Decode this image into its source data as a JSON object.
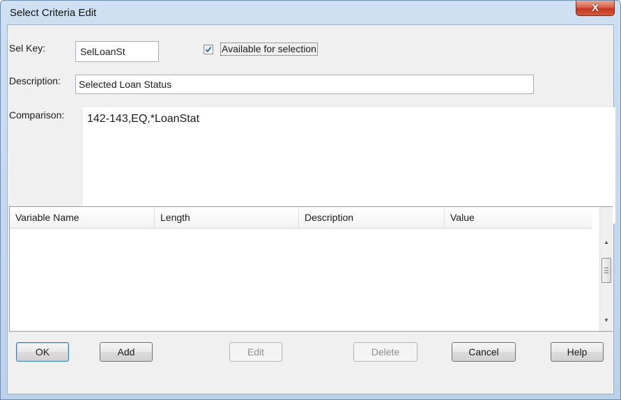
{
  "window": {
    "title": "Select Criteria Edit",
    "close_glyph": "X"
  },
  "form": {
    "sel_key_label": "Sel Key:",
    "sel_key_value": "SelLoanSt",
    "available_checked": true,
    "available_label": "Available for selection",
    "description_label": "Description:",
    "description_value": "Selected Loan Status",
    "comparison_label": "Comparison:",
    "comparison_value": "142-143,EQ,*LoanStat"
  },
  "grid": {
    "columns": [
      "Variable Name",
      "Length",
      "Description",
      "Value"
    ],
    "rows": []
  },
  "buttons": {
    "ok": "OK",
    "add": "Add",
    "edit": "Edit",
    "delete": "Delete",
    "cancel": "Cancel",
    "help": "Help"
  },
  "icons": {
    "close": "close-icon",
    "check": "checkmark-icon",
    "scroll_up": "arrow-up-icon",
    "scroll_down": "arrow-down-icon",
    "grip": "grip-icon"
  }
}
